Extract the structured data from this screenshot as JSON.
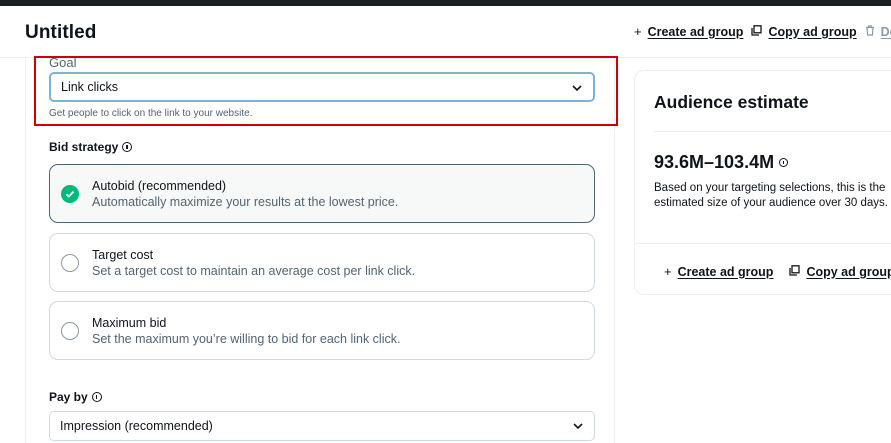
{
  "header": {
    "title": "Untitled",
    "actions": [
      {
        "icon": "plus-icon",
        "label": "Create ad group"
      },
      {
        "icon": "copy-icon",
        "label": "Copy ad group"
      },
      {
        "icon": "trash-icon",
        "label": "De"
      }
    ]
  },
  "goal": {
    "label_partial": "Goal",
    "value": "Link clicks",
    "helper": "Get people to click on the link to your website."
  },
  "bid_strategy": {
    "label": "Bid strategy",
    "options": [
      {
        "title": "Autobid (recommended)",
        "description": "Automatically maximize your results at the lowest price.",
        "selected": true
      },
      {
        "title": "Target cost",
        "description": "Set a target cost to maintain an average cost per link click.",
        "selected": false
      },
      {
        "title": "Maximum bid",
        "description": "Set the maximum you’re willing to bid for each link click.",
        "selected": false
      }
    ]
  },
  "pay_by": {
    "label": "Pay by",
    "value": "Impression (recommended)"
  },
  "audience": {
    "title": "Audience estimate",
    "range": "93.6M–103.4M",
    "description": "Based on your targeting selections, this is the estimated size of your audience over 30 days.",
    "actions": [
      {
        "icon": "plus-icon",
        "label": "Create ad group"
      },
      {
        "icon": "copy-icon",
        "label": "Copy ad group"
      }
    ]
  },
  "colors": {
    "selected_check": "#00ba7c",
    "highlight_box": "#d40000",
    "focus_border": "#78b4d6"
  }
}
